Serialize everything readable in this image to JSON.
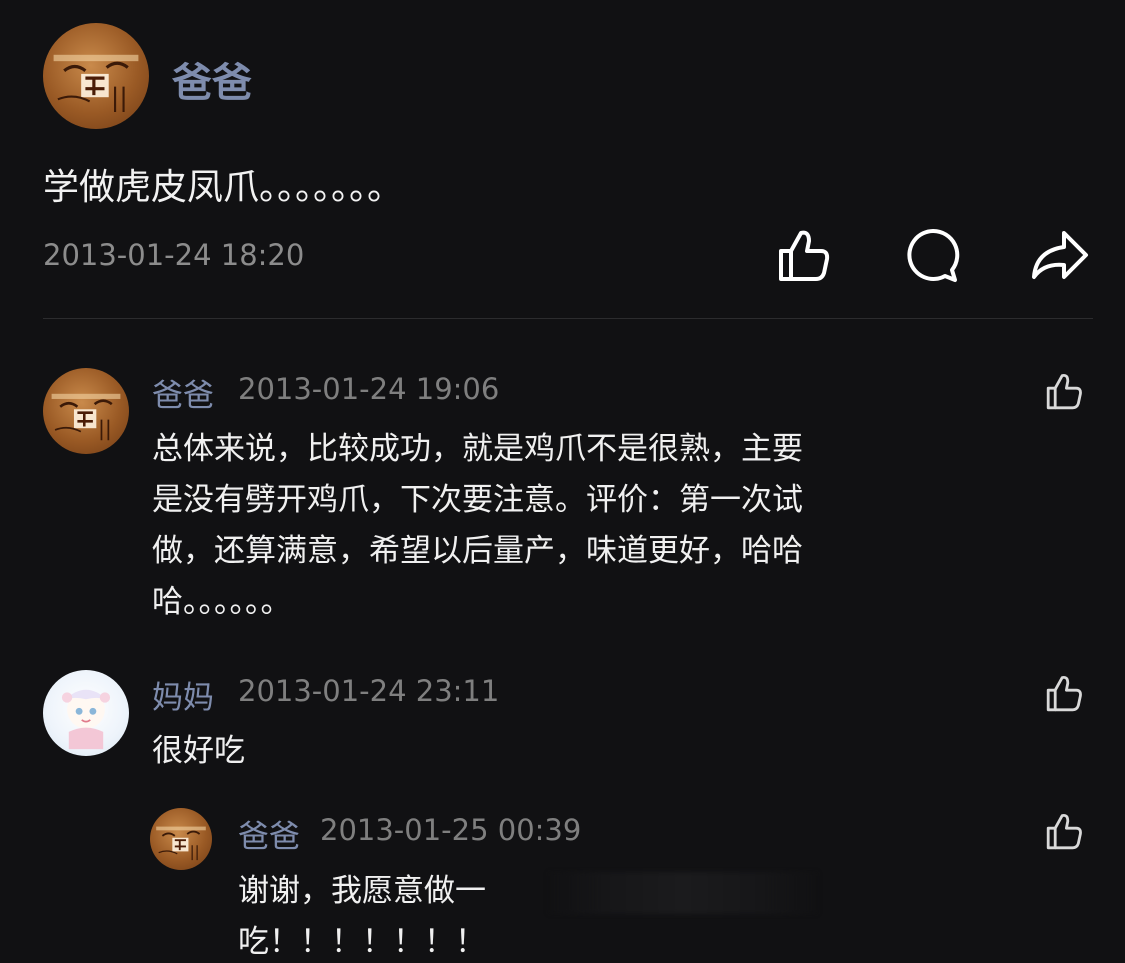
{
  "post": {
    "author": "爸爸",
    "text": "学做虎皮凤爪。。。。。。。",
    "time": "2013-01-24 18:20",
    "actions": [
      "like-icon",
      "comment-icon",
      "share-icon"
    ]
  },
  "comments": [
    {
      "author": "爸爸",
      "time": "2013-01-24 19:06",
      "lines": [
        "总体来说，比较成功，就是鸡爪不是很熟，主要",
        "是没有劈开鸡爪，下次要注意。评价：第一次试",
        "做，还算满意，希望以后量产，味道更好，哈哈",
        "哈。。。。。。"
      ]
    },
    {
      "author": "妈妈",
      "time": "2013-01-24 23:11",
      "text": "很好吃"
    },
    {
      "author": "爸爸",
      "time": "2013-01-25 00:39",
      "lines": [
        "谢谢，我愿意做一",
        "吃！！！！！！！"
      ]
    }
  ],
  "colors": {
    "background": "#111113",
    "name": "#7e8cad",
    "text": "#f0f0f0",
    "meta": "#7f7f7f"
  }
}
